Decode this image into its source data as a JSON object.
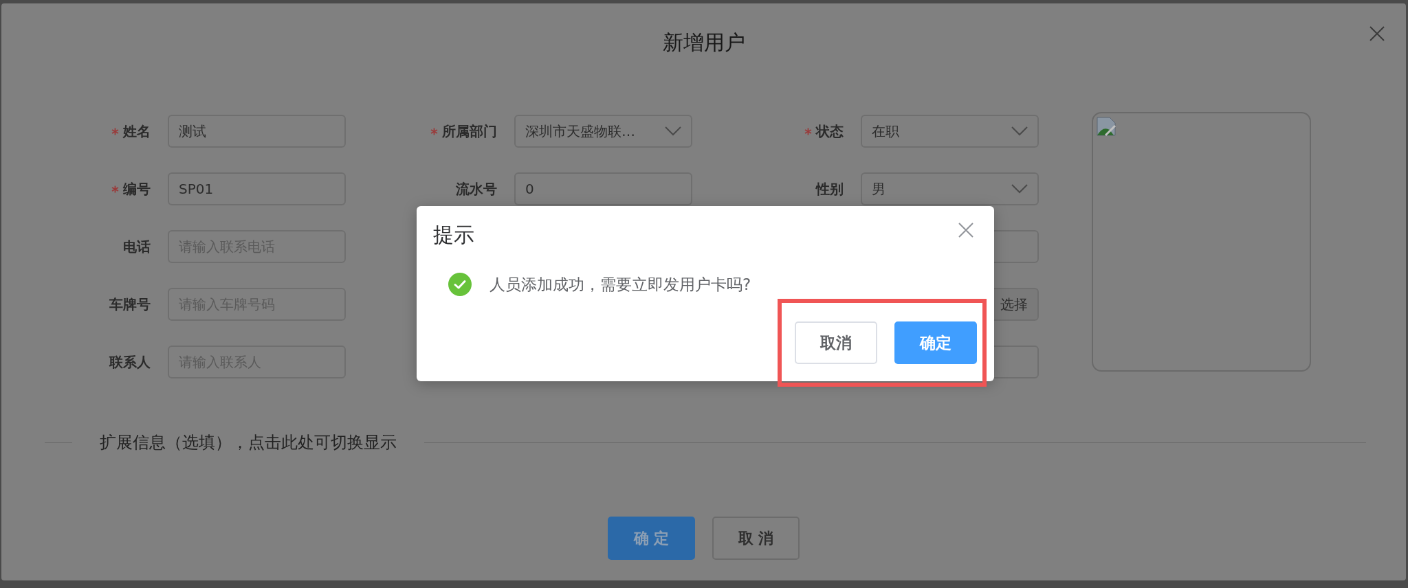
{
  "dialog": {
    "title": "新增用户"
  },
  "form": {
    "columns": [
      [
        {
          "label": "姓名",
          "required": true,
          "kind": "input",
          "value": "测试"
        },
        {
          "label": "编号",
          "required": true,
          "kind": "input",
          "value": "SP01"
        },
        {
          "label": "电话",
          "required": false,
          "kind": "input",
          "placeholder": "请输入联系电话"
        },
        {
          "label": "车牌号",
          "required": false,
          "kind": "input",
          "placeholder": "请输入车牌号码"
        },
        {
          "label": "联系人",
          "required": false,
          "kind": "input",
          "placeholder": "请输入联系人"
        }
      ],
      [
        {
          "label": "所属部门",
          "required": true,
          "kind": "select",
          "value": "深圳市天盛物联…"
        },
        {
          "label": "流水号",
          "required": false,
          "kind": "input",
          "value": "0"
        }
      ],
      [
        {
          "label": "状态",
          "required": true,
          "kind": "select",
          "value": "在职"
        },
        {
          "label": "性别",
          "required": false,
          "kind": "select",
          "value": "男"
        },
        {
          "kind": "input"
        },
        {
          "kind": "append",
          "button": "选择"
        },
        {
          "kind": "input"
        }
      ]
    ]
  },
  "extension_toggle": "扩展信息（选填），点击此处可切换显示",
  "footer_buttons": [
    {
      "label": "确 定",
      "kind": "primary"
    },
    {
      "label": "取 消",
      "kind": "default"
    }
  ],
  "message_box": {
    "title": "提示",
    "kind": "success",
    "message": "人员添加成功，需要立即发用户卡吗?",
    "highlight_buttons": true,
    "buttons": [
      {
        "label": "取消",
        "kind": "default"
      },
      {
        "label": "确定",
        "kind": "primary"
      }
    ]
  }
}
